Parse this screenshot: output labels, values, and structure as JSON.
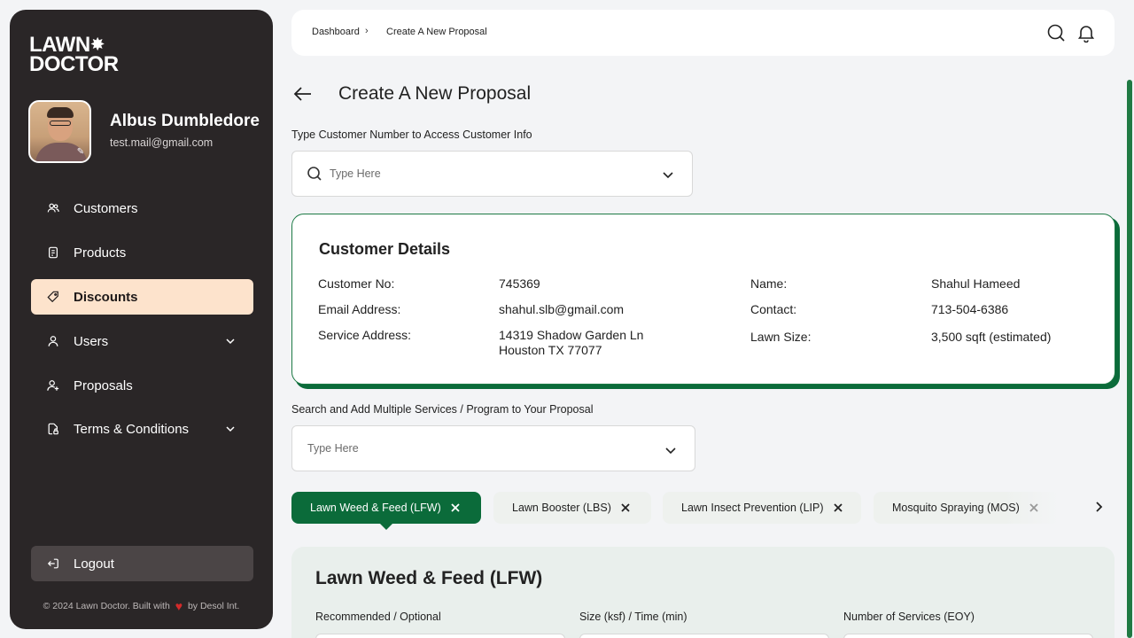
{
  "sidebar": {
    "logo_line1": "LAWN",
    "logo_line2": "DOCTOR",
    "user_name": "Albus Dumbledore",
    "user_email": "test.mail@gmail.com",
    "items": [
      {
        "label": "Customers",
        "icon": "users-icon"
      },
      {
        "label": "Products",
        "icon": "document-icon"
      },
      {
        "label": "Discounts",
        "icon": "tag-icon",
        "active": true
      },
      {
        "label": "Users",
        "icon": "user-icon",
        "expandable": true
      },
      {
        "label": "Proposals",
        "icon": "user-plus-icon"
      },
      {
        "label": "Terms & Conditions",
        "icon": "file-lock-icon",
        "expandable": true
      }
    ],
    "logout_label": "Logout",
    "footer_prefix": "© 2024 Lawn Doctor. Built with",
    "footer_suffix": "by Desol Int.",
    "active_bg": "#fde3cc",
    "bg": "#2a2627"
  },
  "header": {
    "breadcrumb": [
      "Dashboard",
      "Create A New Proposal"
    ]
  },
  "main": {
    "title": "Create A New Proposal",
    "customer_search": {
      "label": "Type Customer Number to Access Customer Info",
      "placeholder": "Type Here"
    },
    "customer_details": {
      "title": "Customer Details",
      "fields": [
        {
          "label": "Customer No:",
          "value": "745369"
        },
        {
          "label": "Email Address:",
          "value": "shahul.slb@gmail.com"
        },
        {
          "label": "Service Address:",
          "value_line1": "14319 Shadow Garden Ln",
          "value_line2": "Houston TX 77077"
        },
        {
          "label": "Name:",
          "value": "Shahul Hameed"
        },
        {
          "label": "Contact:",
          "value": "713-504-6386"
        },
        {
          "label": "Lawn Size:",
          "value": "3,500 sqft (estimated)"
        }
      ]
    },
    "service_search": {
      "label": "Search and Add Multiple Services / Program to Your Proposal",
      "placeholder": "Type Here"
    },
    "service_tabs": [
      {
        "label": "Lawn Weed & Feed (LFW)",
        "active": true
      },
      {
        "label": "Lawn Booster (LBS)"
      },
      {
        "label": "Lawn Insect Prevention (LIP)"
      },
      {
        "label": "Mosquito Spraying (MOS)"
      }
    ],
    "service_panel": {
      "title": "Lawn Weed & Feed (LFW)",
      "columns": [
        "Recommended / Optional",
        "Size (ksf) / Time (min)",
        "Number of Services (EOY)"
      ]
    },
    "accent_color": "#0b6b3a"
  }
}
